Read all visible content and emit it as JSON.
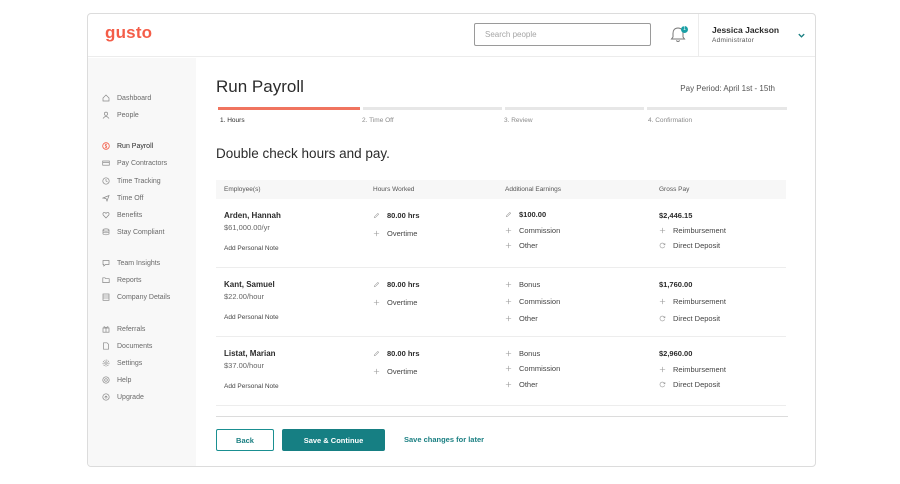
{
  "header": {
    "logo": "gusto",
    "search_placeholder": "Search people",
    "notification_count": "1",
    "user_name": "Jessica Jackson",
    "user_role": "Administrator"
  },
  "sidebar": {
    "items": [
      {
        "label": "Dashboard",
        "icon": "home-icon"
      },
      {
        "label": "People",
        "icon": "person-icon"
      },
      {
        "label": "Run Payroll",
        "icon": "dollar-icon"
      },
      {
        "label": "Pay Contractors",
        "icon": "card-icon"
      },
      {
        "label": "Time Tracking",
        "icon": "clock-icon"
      },
      {
        "label": "Time Off",
        "icon": "plane-icon"
      },
      {
        "label": "Benefits",
        "icon": "heart-icon"
      },
      {
        "label": "Stay Compliant",
        "icon": "database-icon"
      },
      {
        "label": "Team Insights",
        "icon": "chat-icon"
      },
      {
        "label": "Reports",
        "icon": "folder-icon"
      },
      {
        "label": "Company Details",
        "icon": "building-icon"
      },
      {
        "label": "Referrals",
        "icon": "gift-icon"
      },
      {
        "label": "Documents",
        "icon": "document-icon"
      },
      {
        "label": "Settings",
        "icon": "gear-icon"
      },
      {
        "label": "Help",
        "icon": "help-icon"
      },
      {
        "label": "Upgrade",
        "icon": "upgrade-icon"
      }
    ]
  },
  "main": {
    "title": "Run Payroll",
    "pay_period": "Pay Period: April 1st - 15th",
    "steps": [
      "1. Hours",
      "2. Time Off",
      "3. Review",
      "4. Confirmation"
    ],
    "subtitle": "Double check hours and pay.",
    "columns": [
      "Employee(s)",
      "Hours Worked",
      "Additional Earnings",
      "Gross Pay"
    ],
    "employees": [
      {
        "name": "Arden, Hannah",
        "rate": "$61,000.00/yr",
        "note": "Add Personal Note",
        "hours": "80.00 hrs",
        "overtime": "Overtime",
        "earnings": [
          "$100.00",
          "Commission",
          "Other"
        ],
        "gross": "$2,446.15",
        "reimbursement": "Reimbursement",
        "deposit": "Direct Deposit"
      },
      {
        "name": "Kant, Samuel",
        "rate": "$22.00/hour",
        "note": "Add Personal Note",
        "hours": "80.00 hrs",
        "overtime": "Overtime",
        "earnings": [
          "Bonus",
          "Commission",
          "Other"
        ],
        "gross": "$1,760.00",
        "reimbursement": "Reimbursement",
        "deposit": "Direct Deposit"
      },
      {
        "name": "Listat, Marian",
        "rate": "$37.00/hour",
        "note": "Add Personal Note",
        "hours": "80.00 hrs",
        "overtime": "Overtime",
        "earnings": [
          "Bonus",
          "Commission",
          "Other"
        ],
        "gross": "$2,960.00",
        "reimbursement": "Reimbursement",
        "deposit": "Direct Deposit"
      }
    ]
  },
  "footer": {
    "back": "Back",
    "save_continue": "Save & Continue",
    "save_later": "Save changes for later"
  },
  "colors": {
    "brand": "#f45d48",
    "accent": "#167f83",
    "progress": "#f0745f"
  }
}
